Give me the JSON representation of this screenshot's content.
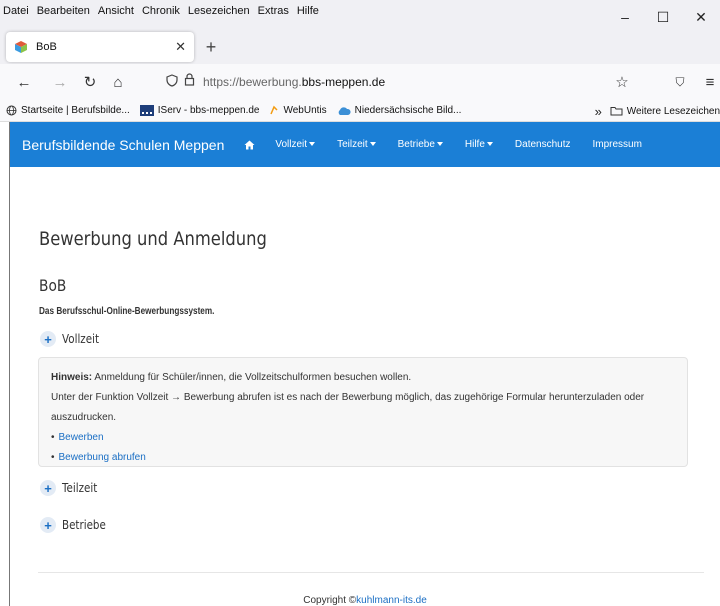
{
  "menubar": {
    "items": [
      "Datei",
      "Bearbeiten",
      "Ansicht",
      "Chronik",
      "Lesezeichen",
      "Extras",
      "Hilfe"
    ]
  },
  "window": {
    "minimize": "–",
    "maximize": "☐",
    "close": "✕"
  },
  "tab": {
    "title": "BoB",
    "close": "✕",
    "new_tab": "+"
  },
  "nav": {
    "back": "←",
    "forward": "→",
    "reload": "↻",
    "home": "⌂",
    "url_prefix": "https://bewerbung.",
    "url_domain": "bbs-meppen.de",
    "star": "☆",
    "pocket": "⛉",
    "menu": "≡"
  },
  "bookmarks": {
    "items": [
      "Startseite | Berufsbilde...",
      "IServ - bbs-meppen.de",
      "WebUntis",
      "Niedersächsische Bild..."
    ],
    "overflow": "»",
    "other": "Weitere Lesezeichen"
  },
  "site_nav": {
    "brand": "Berufsbildende Schulen Meppen",
    "links": [
      "Vollzeit",
      "Teilzeit",
      "Betriebe",
      "Hilfe",
      "Datenschutz",
      "Impressum"
    ]
  },
  "page": {
    "title": "Bewerbung und Anmeldung",
    "heading": "BoB",
    "subtitle": "Das Berufsschul-Online-Bewerbungssystem.",
    "sections": [
      "Vollzeit",
      "Teilzeit",
      "Betriebe"
    ],
    "plus": "+"
  },
  "panel": {
    "hint_label": "Hinweis:",
    "hint_text": " Anmeldung für Schüler/innen, die Vollzeitschulformen besuchen wollen.",
    "info_line1": "Unter der Funktion Vollzeit → Bewerbung abrufen ist es nach der Bewerbung möglich, das zugehörige Formular herunterzuladen oder",
    "info_line2": "auszudrucken.",
    "links": [
      "Bewerben",
      "Bewerbung abrufen"
    ]
  },
  "footer": {
    "text": "Copyright ©",
    "link": "kuhlmann-its.de"
  },
  "colors": {
    "brand_blue": "#1b7fd6",
    "link": "#1b6fc4"
  }
}
